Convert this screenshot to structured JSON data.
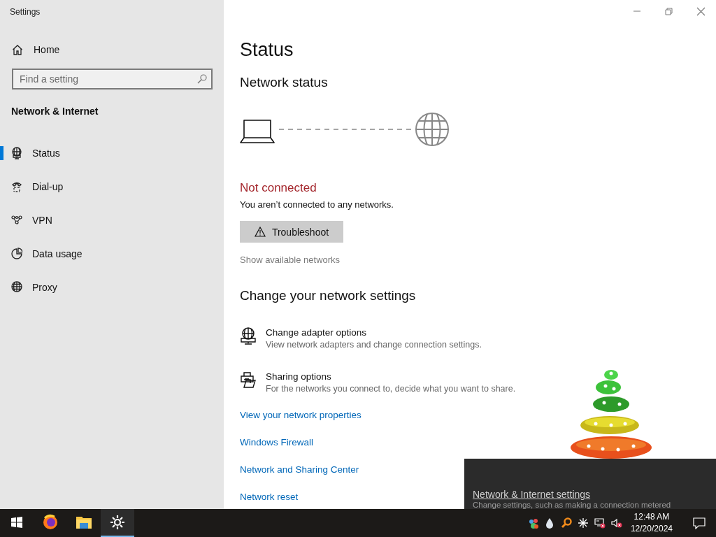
{
  "window": {
    "title": "Settings"
  },
  "sidebar": {
    "home": "Home",
    "search": {
      "placeholder": "Find a setting"
    },
    "section": "Network & Internet",
    "items": [
      {
        "kind": "status",
        "label": "Status",
        "selected": true
      },
      {
        "kind": "dialup",
        "label": "Dial-up",
        "selected": false
      },
      {
        "kind": "vpn",
        "label": "VPN",
        "selected": false
      },
      {
        "kind": "data",
        "label": "Data usage",
        "selected": false
      },
      {
        "kind": "proxy",
        "label": "Proxy",
        "selected": false
      }
    ]
  },
  "content": {
    "title": "Status",
    "subtitle": "Network status",
    "connected": false,
    "state": "Not connected",
    "detail": "You aren’t connected to any networks.",
    "troubleshoot": "Troubleshoot",
    "show_networks": "Show available networks",
    "heading": "Change your network settings",
    "options": [
      {
        "kind": "adapter",
        "title": "Change adapter options",
        "description": "View network adapters and change connection settings."
      },
      {
        "kind": "sharing",
        "title": "Sharing options",
        "description": "For the networks you connect to, decide what you want to share."
      }
    ],
    "links": [
      "View your network properties",
      "Windows Firewall",
      "Network and Sharing Center",
      "Network reset"
    ]
  },
  "flyout": {
    "link": "Network & Internet settings",
    "description": "Change settings, such as making a connection metered"
  },
  "taskbar": {
    "apps": [
      {
        "kind": "browser",
        "selected": false
      },
      {
        "kind": "folder",
        "selected": false
      },
      {
        "kind": "settings",
        "selected": true
      }
    ],
    "time": "12:48 AM",
    "date": "12/20/2024"
  }
}
